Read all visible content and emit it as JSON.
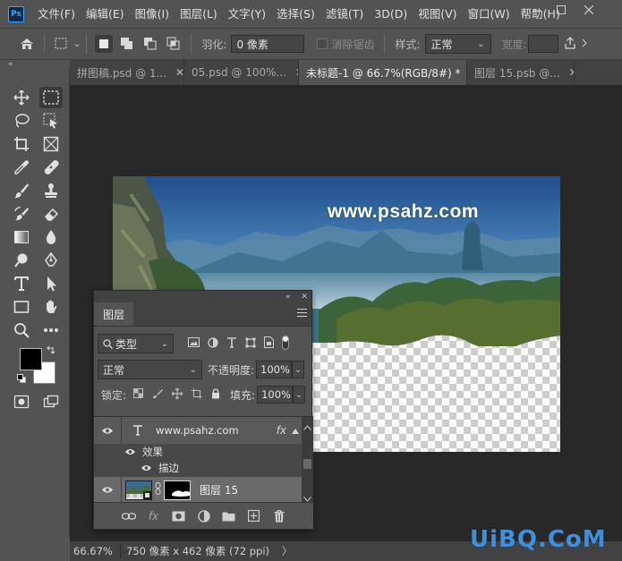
{
  "menu": [
    "文件(F)",
    "编辑(E)",
    "图像(I)",
    "图层(L)",
    "文字(Y)",
    "选择(S)",
    "滤镜(T)",
    "3D(D)",
    "视图(V)",
    "窗口(W)",
    "帮助(H)"
  ],
  "app_logo": "Ps",
  "options": {
    "feather_label": "羽化:",
    "feather_value": "0 像素",
    "antialias_label": "消除锯齿",
    "style_label": "样式:",
    "style_value": "正常",
    "width_label": "宽度:"
  },
  "tabs": [
    {
      "label": "拼图稿.psd @ 1..."
    },
    {
      "label": "05.psd @ 100%..."
    },
    {
      "label": "未标题-1 @ 66.7%(RGB/8#) *",
      "active": true
    },
    {
      "label": "图层 15.psb @..."
    }
  ],
  "document": {
    "overlay_text": "www.psahz.com"
  },
  "layers_panel": {
    "tab_label": "图层",
    "filter_kind": "类型",
    "blend_mode": "正常",
    "opacity_label": "不透明度:",
    "opacity_value": "100%",
    "lock_label": "锁定:",
    "fill_label": "填充:",
    "fill_value": "100%",
    "layers": [
      {
        "name": "www.psahz.com",
        "type": "text",
        "fx": "fx"
      },
      {
        "name": "效果",
        "type": "effect-group"
      },
      {
        "name": "描边",
        "type": "effect"
      },
      {
        "name": "图层 15",
        "type": "smart"
      }
    ]
  },
  "status": {
    "zoom": "66.67%",
    "doc_info": "750 像素 x 462 像素 (72 ppi)",
    "arrow": "〉"
  },
  "watermark": "UiBQ.CoM",
  "colors": {
    "foreground": "#000000",
    "background": "#ffffff",
    "accent": "#31a8ff"
  }
}
